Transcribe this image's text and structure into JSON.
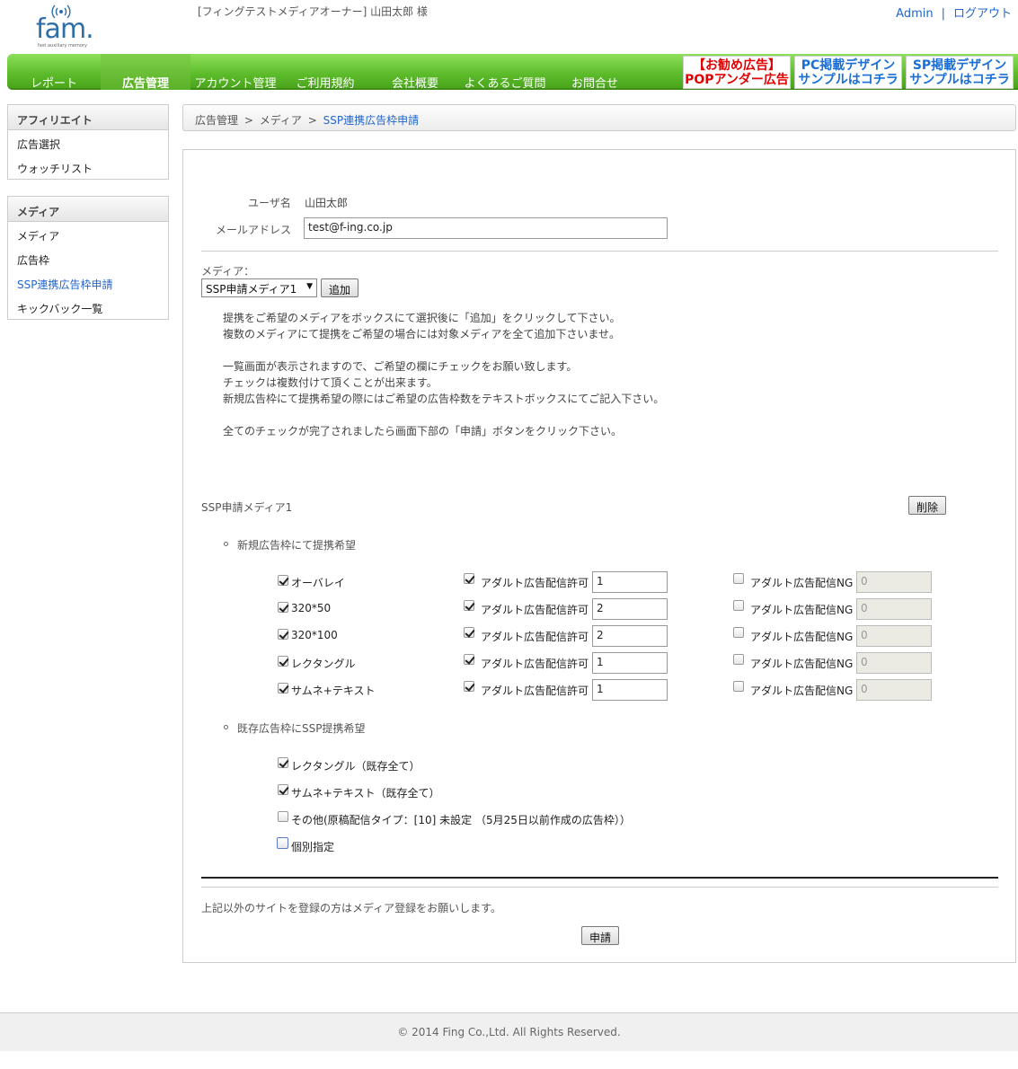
{
  "header": {
    "logo_text": "fam.",
    "logo_subtitle": "fast auxiliary memory",
    "user_line": "[フィングテストメディアオーナー] 山田太郎 様",
    "admin_link": "Admin",
    "link_separator": "|",
    "logout_link": "ログアウト"
  },
  "nav": {
    "items": [
      "レポート",
      "広告管理",
      "アカウント管理",
      "ご利用規約",
      "会社概要",
      "よくあるご質問",
      "お問合せ"
    ],
    "active_index": 1,
    "banners": [
      {
        "line1": "【お勧め広告】",
        "line2": "POPアンダー広告",
        "color": "#e30000"
      },
      {
        "line1": "PC掲載デザイン",
        "line2": "サンプルはコチラ",
        "color": "#1a6fd6"
      },
      {
        "line1": "SP掲載デザイン",
        "line2": "サンプルはコチラ",
        "color": "#1a6fd6"
      }
    ]
  },
  "sidebar": {
    "sections": [
      {
        "title": "アフィリエイト",
        "items": [
          "広告選択",
          "ウォッチリスト"
        ]
      },
      {
        "title": "メディア",
        "items": [
          "メディア",
          "広告枠",
          "SSP連携広告枠申請",
          "キックバック一覧"
        ]
      }
    ]
  },
  "breadcrumb": {
    "items": [
      "広告管理",
      "メディア",
      "SSP連携広告枠申請"
    ],
    "separator": ">"
  },
  "form": {
    "user_label": "ユーザ名",
    "user_value": "山田太郎",
    "email_label": "メールアドレス",
    "email_value": "test@f-ing.co.jp",
    "media_label": "メディア：",
    "media_selected": "SSP申請メディア1",
    "add_button": "追加",
    "instructions": [
      "提携をご希望のメディアをボックスにて選択後に「追加」をクリックして下さい。",
      "複数のメディアにて提携をご希望の場合には対象メディアを全て追加下さいませ。",
      "",
      "一覧画面が表示されますので、ご希望の欄にチェックをお願い致します。",
      "チェックは複数付けて頂くことが出来ます。",
      "新規広告枠にて提携希望の際にはご希望の広告枠数をテキストボックスにてご記入下さい。",
      "",
      "全てのチェックが完了されましたら画面下部の「申請」ボタンをクリック下さい。"
    ]
  },
  "media_block": {
    "title": "SSP申請メディア1",
    "delete_button": "削除",
    "new_heading": "新規広告枠にて提携希望",
    "adult_ok_label": "アダルト広告配信許可",
    "adult_ng_label": "アダルト広告配信NG",
    "rows": [
      {
        "name": "オーバレイ",
        "checked": true,
        "adult_ok": true,
        "ok_count": "1",
        "adult_ng": false,
        "ng_count": "0"
      },
      {
        "name": "320*50",
        "checked": true,
        "adult_ok": true,
        "ok_count": "2",
        "adult_ng": false,
        "ng_count": "0"
      },
      {
        "name": "320*100",
        "checked": true,
        "adult_ok": true,
        "ok_count": "2",
        "adult_ng": false,
        "ng_count": "0"
      },
      {
        "name": "レクタングル",
        "checked": true,
        "adult_ok": true,
        "ok_count": "1",
        "adult_ng": false,
        "ng_count": "0"
      },
      {
        "name": "サムネ+テキスト",
        "checked": true,
        "adult_ok": true,
        "ok_count": "1",
        "adult_ng": false,
        "ng_count": "0"
      }
    ],
    "existing_heading": "既存広告枠にSSP提携希望",
    "existing_options": [
      {
        "label": "レクタングル（既存全て）",
        "checked": true
      },
      {
        "label": "サムネ+テキスト（既存全て）",
        "checked": true
      },
      {
        "label": "その他(原稿配信タイプ：[10] 未設定 （5月25日以前作成の広告枠））",
        "checked": false
      },
      {
        "label": "個別指定",
        "checked": false
      }
    ]
  },
  "bottom": {
    "note": "上記以外のサイトを登録の方はメディア登録をお願いします。",
    "submit_button": "申請"
  },
  "footer": {
    "copyright": "© 2014 Fing Co.,Ltd. All Rights Reserved."
  }
}
